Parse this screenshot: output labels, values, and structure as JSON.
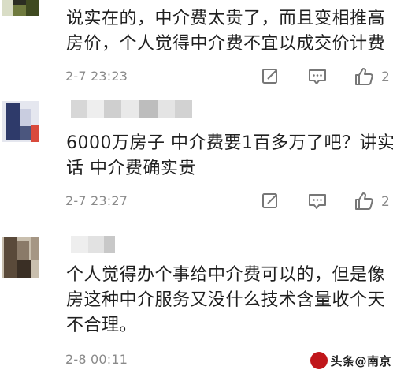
{
  "comments": [
    {
      "username": "",
      "text_lines": [
        "说实在的，中介费太贵了，而且变相推高",
        "房价，个人觉得中介费不宜以成交价计费"
      ],
      "time": "2-7 23:23",
      "like_count": "2",
      "avatar_colors": [
        "#6f7a3e",
        "#3f4a20",
        "#b7c08a",
        "#2b2d22"
      ]
    },
    {
      "username": "",
      "text_lines": [
        "6000万房子 中介费要1百多万了吧？讲实",
        "话 中介费确实贵"
      ],
      "time": "2-7 23:27",
      "like_count": "2",
      "avatar_colors": [
        "#2e3a6a",
        "#c9cde0",
        "#d94a3c",
        "#e5e7ef"
      ]
    },
    {
      "username": "",
      "text_lines": [
        "个人觉得办个事给中介费可以的，但是像",
        "房这种中介服务又没什么技术含量收个天",
        "不合理。"
      ],
      "time": "2-8 00:11",
      "like_count": "",
      "avatar_colors": [
        "#5a4a3a",
        "#8a7a68",
        "#3a2f25",
        "#c9bfae"
      ]
    }
  ],
  "watermark": {
    "text": "头条@南京"
  },
  "icons": {
    "comment": "edit-square-icon",
    "reply": "message-dots-icon",
    "like": "thumbs-up-icon"
  },
  "colors": {
    "text": "#1f1f1f",
    "meta": "#8a8a8a",
    "icon": "#7a7a7a"
  }
}
